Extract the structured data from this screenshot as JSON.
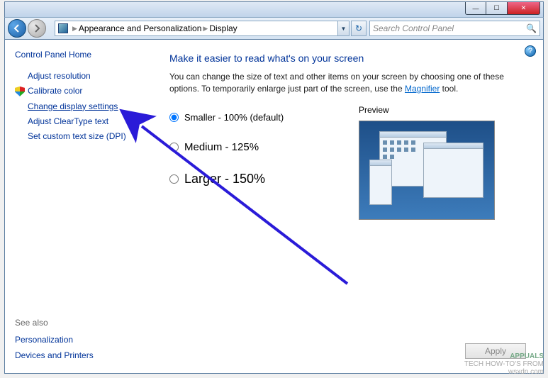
{
  "window": {
    "minimize_glyph": "—",
    "maximize_glyph": "☐",
    "close_glyph": "✕"
  },
  "nav": {
    "path_category": "Appearance and Personalization",
    "path_page": "Display",
    "search_placeholder": "Search Control Panel"
  },
  "sidebar": {
    "home": "Control Panel Home",
    "tasks": [
      {
        "label": "Adjust resolution",
        "shield": false,
        "active": false
      },
      {
        "label": "Calibrate color",
        "shield": true,
        "active": false
      },
      {
        "label": "Change display settings",
        "shield": false,
        "active": true
      },
      {
        "label": "Adjust ClearType text",
        "shield": false,
        "active": false
      },
      {
        "label": "Set custom text size (DPI)",
        "shield": false,
        "active": false
      }
    ],
    "seealso_heading": "See also",
    "seealso": [
      "Personalization",
      "Devices and Printers"
    ]
  },
  "main": {
    "heading": "Make it easier to read what's on your screen",
    "desc1": "You can change the size of text and other items on your screen by choosing one of these options. To temporarily enlarge just part of the screen, use the ",
    "magnifier_link": "Magnifier",
    "desc2": " tool.",
    "options": [
      {
        "label": "Smaller - 100% (default)",
        "checked": true,
        "size": "sm"
      },
      {
        "label": "Medium - 125%",
        "checked": false,
        "size": "med"
      },
      {
        "label": "Larger - 150%",
        "checked": false,
        "size": "lrg"
      }
    ],
    "preview_label": "Preview",
    "apply_label": "Apply"
  },
  "watermark": {
    "brand": "APPUALS",
    "tagline": "TECH HOW-TO'S FROM",
    "site": "wsxdn.com"
  }
}
